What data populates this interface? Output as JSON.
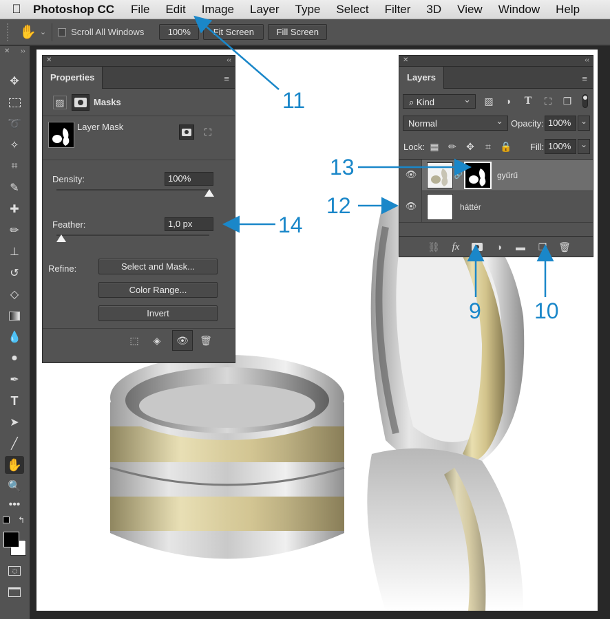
{
  "menubar": {
    "app_name": "Photoshop CC",
    "items": [
      "File",
      "Edit",
      "Image",
      "Layer",
      "Type",
      "Select",
      "Filter",
      "3D",
      "View",
      "Window",
      "Help"
    ]
  },
  "options_bar": {
    "scroll_all_windows": "Scroll All Windows",
    "zoom": "100%",
    "fit_screen": "Fit Screen",
    "fill_screen": "Fill Screen"
  },
  "properties": {
    "tab": "Properties",
    "section": "Masks",
    "mask_label": "Layer Mask",
    "density_label": "Density:",
    "density_value": "100%",
    "density_level_percent": 100,
    "feather_label": "Feather:",
    "feather_value": "1,0 px",
    "feather_level_percent": 3,
    "refine_label": "Refine:",
    "buttons": [
      "Select and Mask...",
      "Color Range...",
      "Invert"
    ]
  },
  "layers": {
    "tab": "Layers",
    "filter_kind": "Kind",
    "blend_mode": "Normal",
    "opacity_label": "Opacity:",
    "opacity_value": "100%",
    "lock_label": "Lock:",
    "fill_label": "Fill:",
    "fill_value": "100%",
    "rows": [
      {
        "name": "gyűrű",
        "visible": true,
        "selected": true
      },
      {
        "name": "háttér",
        "visible": true,
        "selected": false
      }
    ],
    "fx_label": "fx"
  },
  "callouts": [
    "11",
    "12",
    "13",
    "14",
    "9",
    "10"
  ],
  "colors": {
    "callout": "#1a87c9",
    "panel_bg": "#535353",
    "menubar_bg": "#e4e4e4"
  }
}
